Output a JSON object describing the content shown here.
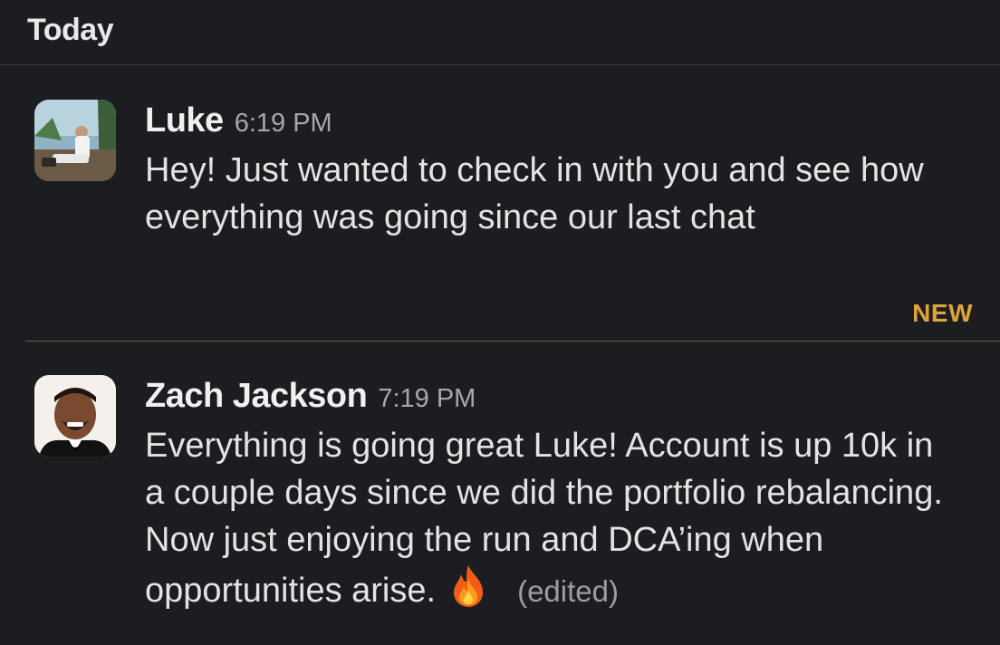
{
  "day_header": {
    "label": "Today"
  },
  "new_divider": {
    "label": "NEW",
    "color": "#e0a33a"
  },
  "messages": [
    {
      "sender": "Luke",
      "time": "6:19 PM",
      "text": "Hey! Just wanted to check in with you and see how everything was going since our last chat",
      "avatar_icon": "user-photo-icon"
    },
    {
      "sender": "Zach Jackson",
      "time": "7:19 PM",
      "text": "Everything is going great Luke! Account is up 10k in a couple days since we did the portfolio rebalancing. Now just enjoying the run and DCA’ing when opportunities arise.",
      "emoji": "fire-icon",
      "edited_label": "(edited)",
      "avatar_icon": "user-photo-icon"
    }
  ],
  "colors": {
    "background": "#1b1d21",
    "text": "#e3e3e4",
    "muted": "#a6a8ab",
    "accent_new": "#e0a33a"
  }
}
